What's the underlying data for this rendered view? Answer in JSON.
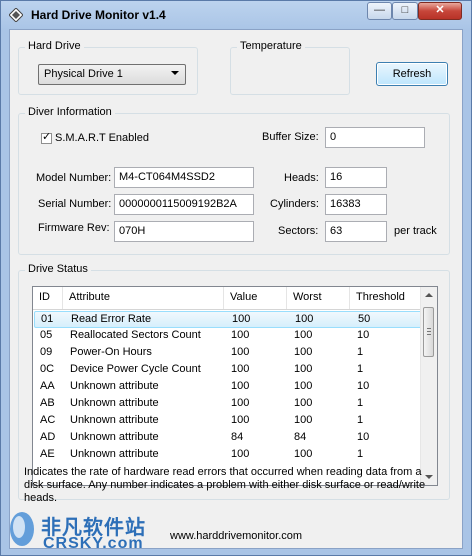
{
  "window": {
    "title": "Hard Drive Monitor v1.4",
    "min_label": "—",
    "max_label": "□",
    "close_label": "✕"
  },
  "hard_drive": {
    "label": "Hard Drive",
    "selected": "Physical Drive 1"
  },
  "temperature": {
    "label": "Temperature"
  },
  "refresh_label": "Refresh",
  "info": {
    "label": "Diver Information",
    "smart_label": "S.M.A.R.T Enabled",
    "smart_checked": true,
    "buffer_label": "Buffer Size:",
    "buffer_value": "0",
    "model_label": "Model Number:",
    "model_value": "M4-CT064M4SSD2",
    "serial_label": "Serial Number:",
    "serial_value": "0000000115009192B2A",
    "firmware_label": "Firmware Rev:",
    "firmware_value": "070H",
    "heads_label": "Heads:",
    "heads_value": "16",
    "cylinders_label": "Cylinders:",
    "cylinders_value": "16383",
    "sectors_label": "Sectors:",
    "sectors_value": "63",
    "per_track": "per track"
  },
  "status": {
    "label": "Drive Status",
    "columns": [
      "ID",
      "Attribute",
      "Value",
      "Worst",
      "Threshold"
    ],
    "rows": [
      [
        "01",
        "Read Error Rate",
        "100",
        "100",
        "50"
      ],
      [
        "05",
        "Reallocated Sectors Count",
        "100",
        "100",
        "10"
      ],
      [
        "09",
        "Power-On Hours",
        "100",
        "100",
        "1"
      ],
      [
        "0C",
        "Device Power Cycle Count",
        "100",
        "100",
        "1"
      ],
      [
        "AA",
        "Unknown attribute",
        "100",
        "100",
        "10"
      ],
      [
        "AB",
        "Unknown attribute",
        "100",
        "100",
        "1"
      ],
      [
        "AC",
        "Unknown attribute",
        "100",
        "100",
        "1"
      ],
      [
        "AD",
        "Unknown attribute",
        "84",
        "84",
        "10"
      ],
      [
        "AE",
        "Unknown attribute",
        "100",
        "100",
        "1"
      ]
    ],
    "selected_row": 0
  },
  "description": "Indicates the rate of hardware read errors that occurred when reading data from a disk surface. Any number indicates a problem with either disk surface or read/write heads.",
  "footer_url": "www.harddrivemonitor.com",
  "watermark": {
    "text": "非凡软件站",
    "sub": "CRSKY.com"
  }
}
